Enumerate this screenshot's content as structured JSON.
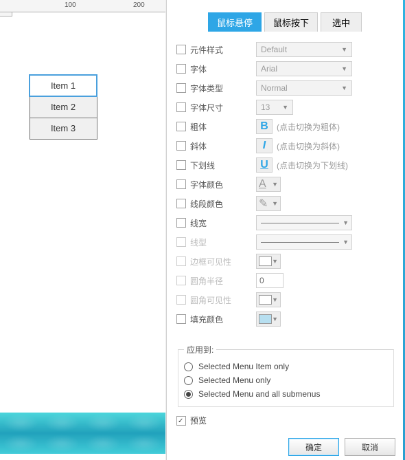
{
  "ruler": {
    "m100": "100",
    "m200": "200"
  },
  "menu_items": [
    "Item 1",
    "Item 2",
    "Item 3"
  ],
  "tabs": {
    "hover": "鼠标悬停",
    "down": "鼠标按下",
    "selected": "选中"
  },
  "props": {
    "widget_style": "元件样式",
    "widget_style_val": "Default",
    "font": "字体",
    "font_val": "Arial",
    "font_type": "字体类型",
    "font_type_val": "Normal",
    "font_size": "字体尺寸",
    "font_size_val": "13",
    "bold": "粗体",
    "bold_hint": "(点击切换为粗体)",
    "italic": "斜体",
    "italic_hint": "(点击切换为斜体)",
    "underline": "下划线",
    "underline_hint": "(点击切换为下划线)",
    "font_color": "字体颜色",
    "line_color": "线段颜色",
    "line_width": "线宽",
    "line_style": "线型",
    "border_vis": "边框可见性",
    "corner_radius": "圆角半径",
    "corner_radius_val": "0",
    "corner_vis": "圆角可见性",
    "fill_color": "填充颜色"
  },
  "apply": {
    "legend": "应用到:",
    "opt1": "Selected Menu Item only",
    "opt2": "Selected Menu only",
    "opt3": "Selected Menu and all submenus"
  },
  "preview_label": "预览",
  "buttons": {
    "ok": "确定",
    "cancel": "取消"
  },
  "colors": {
    "accent": "#2ea6e6"
  }
}
